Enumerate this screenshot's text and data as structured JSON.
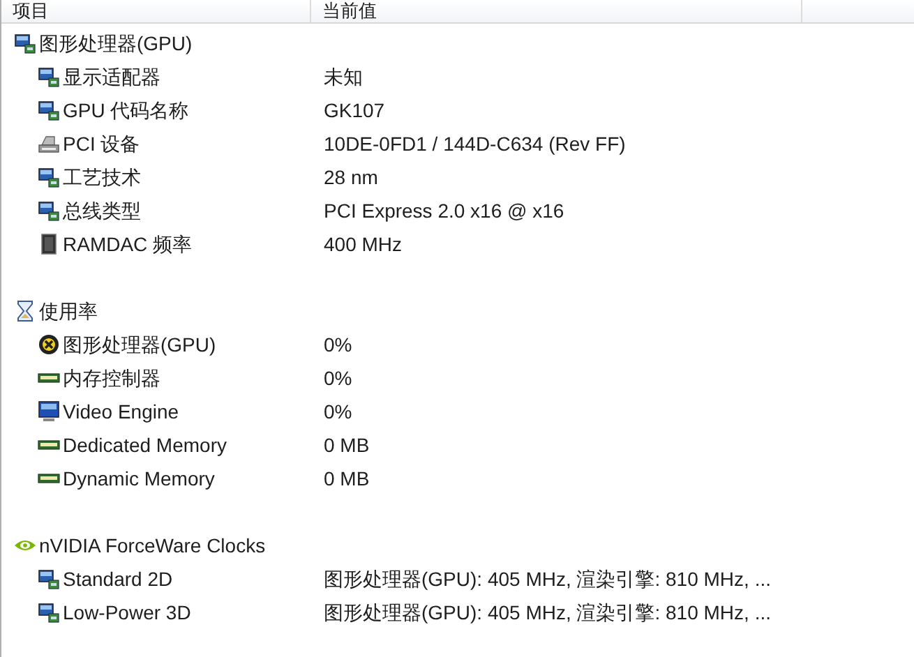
{
  "columns": [
    "项目",
    "当前值"
  ],
  "groups": [
    {
      "label": "图形处理器(GPU)",
      "kind": "gpu",
      "children": [
        {
          "label": "显示适配器",
          "value": "未知",
          "kind": "gpu"
        },
        {
          "label": "GPU 代码名称",
          "value": "GK107",
          "kind": "gpu"
        },
        {
          "label": "PCI 设备",
          "value": "10DE-0FD1 / 144D-C634  (Rev FF)",
          "kind": "pci"
        },
        {
          "label": "工艺技术",
          "value": "28 nm",
          "kind": "gpu"
        },
        {
          "label": "总线类型",
          "value": "PCI Express 2.0 x16 @ x16",
          "kind": "gpu"
        },
        {
          "label": "RAMDAC 频率",
          "value": "400 MHz",
          "kind": "chip"
        }
      ]
    },
    {
      "label": "使用率",
      "kind": "hourglass",
      "children": [
        {
          "label": "图形处理器(GPU)",
          "value": "0%",
          "kind": "gauge"
        },
        {
          "label": "内存控制器",
          "value": "0%",
          "kind": "memory"
        },
        {
          "label": "Video Engine",
          "value": "0%",
          "kind": "monitor"
        },
        {
          "label": "Dedicated Memory",
          "value": "0 MB",
          "kind": "memory"
        },
        {
          "label": "Dynamic Memory",
          "value": "0 MB",
          "kind": "memory"
        }
      ]
    },
    {
      "label": "nVIDIA ForceWare Clocks",
      "kind": "eye",
      "children": [
        {
          "label": "Standard 2D",
          "value": "图形处理器(GPU): 405 MHz, 渲染引擎: 810 MHz, ...",
          "kind": "gpu"
        },
        {
          "label": "Low-Power 3D",
          "value": "图形处理器(GPU): 405 MHz, 渲染引擎: 810 MHz, ...",
          "kind": "gpu"
        }
      ]
    }
  ]
}
